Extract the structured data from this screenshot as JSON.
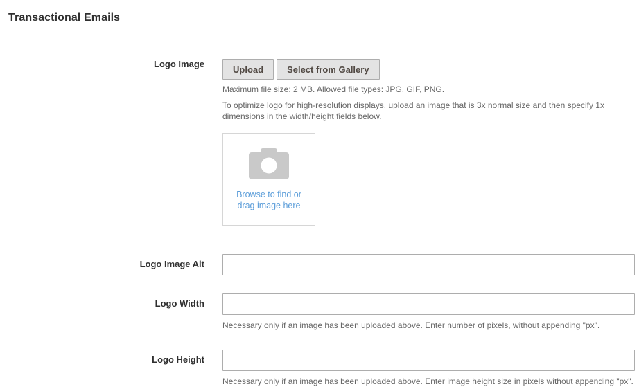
{
  "page": {
    "title": "Transactional Emails"
  },
  "fields": {
    "logo_image": {
      "label": "Logo Image",
      "upload_button": "Upload",
      "gallery_button": "Select from Gallery",
      "note_filesize": "Maximum file size: 2 MB. Allowed file types: JPG, GIF, PNG.",
      "note_optimize": "To optimize logo for high-resolution displays, upload an image that is 3x normal size and then specify 1x dimensions in the width/height fields below.",
      "dropzone_line1": "Browse to find or",
      "dropzone_line2": "drag image here",
      "dropzone_icon": "camera-icon"
    },
    "logo_image_alt": {
      "label": "Logo Image Alt",
      "value": "",
      "placeholder": ""
    },
    "logo_width": {
      "label": "Logo Width",
      "value": "",
      "placeholder": "",
      "note": "Necessary only if an image has been uploaded above. Enter number of pixels, without appending \"px\"."
    },
    "logo_height": {
      "label": "Logo Height",
      "value": "",
      "placeholder": "",
      "note": "Necessary only if an image has been uploaded above. Enter image height size in pixels without appending \"px\"."
    }
  },
  "colors": {
    "text": "#303030",
    "note": "#666666",
    "link": "#5b9dd9",
    "button_bg": "#e3e3e3",
    "button_border": "#adadad",
    "icon_gray": "#c9c9c9"
  }
}
